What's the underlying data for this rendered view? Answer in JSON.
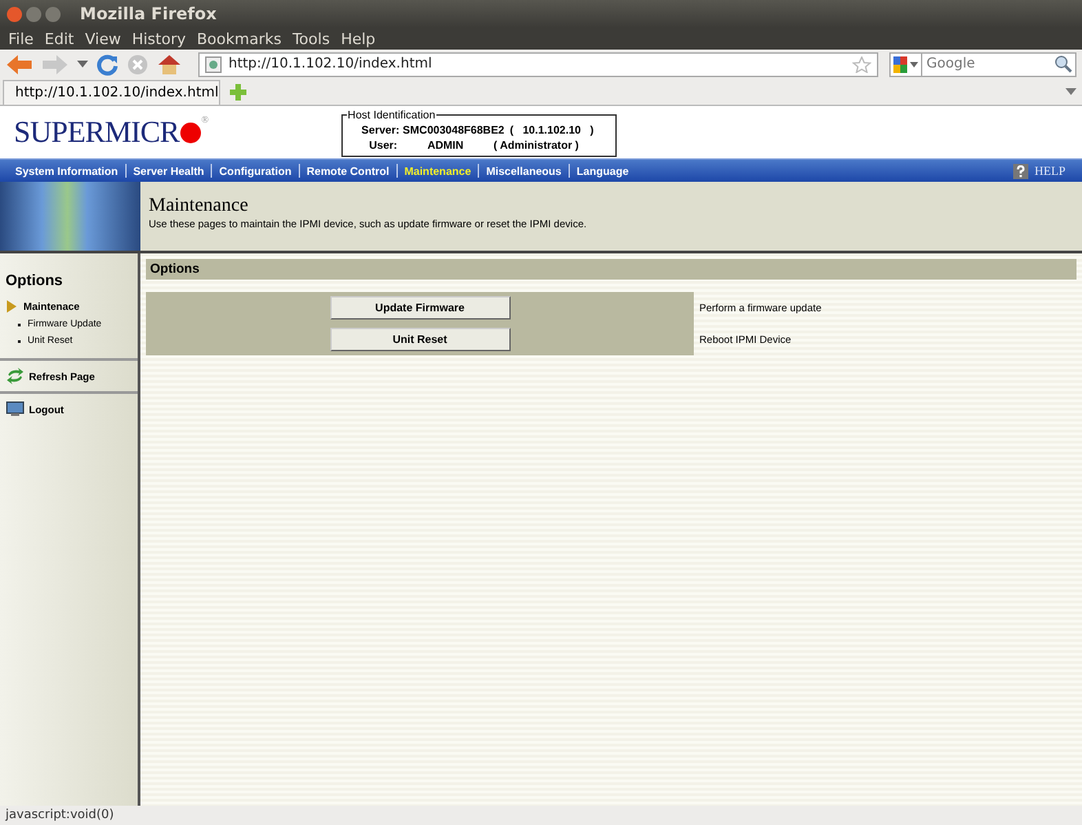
{
  "window": {
    "title": "Mozilla Firefox"
  },
  "menu": [
    "File",
    "Edit",
    "View",
    "History",
    "Bookmarks",
    "Tools",
    "Help"
  ],
  "address_bar": {
    "value": "http://10.1.102.10/index.html"
  },
  "search": {
    "placeholder": "Google"
  },
  "tabs": [
    {
      "label": "http://10.1.102.10/index.html",
      "selected": true
    }
  ],
  "page": {
    "logo": {
      "text": "SUPERMICR",
      "mark": "®"
    },
    "host": {
      "legend": "Host Identification",
      "server_label": "Server:",
      "server": "SMC003048F68BE2",
      "ip": "(   10.1.102.10   )",
      "user_label": "User:",
      "user": "ADMIN",
      "role": "( Administrator )"
    },
    "nav": [
      {
        "label": "System Information",
        "selected": false
      },
      {
        "label": "Server Health",
        "selected": false
      },
      {
        "label": "Configuration",
        "selected": false
      },
      {
        "label": "Remote Control",
        "selected": false
      },
      {
        "label": "Maintenance",
        "selected": true
      },
      {
        "label": "Miscellaneous",
        "selected": false
      },
      {
        "label": "Language",
        "selected": false
      }
    ],
    "help": "HELP",
    "banner": {
      "title": "Maintenance",
      "description": "Use these pages to maintain the IPMI device, such as update firmware or reset the IPMI device."
    },
    "sidebar": {
      "title": "Options",
      "section": "Maintenace",
      "items": [
        "Firmware Update",
        "Unit Reset"
      ],
      "links": [
        {
          "kind": "refresh",
          "label": "Refresh Page"
        },
        {
          "kind": "logout",
          "label": "Logout"
        }
      ]
    },
    "content": {
      "title": "Options",
      "actions": [
        {
          "button": "Update Firmware",
          "description": "Perform a firmware update"
        },
        {
          "button": "Unit Reset",
          "description": "Reboot IPMI Device"
        }
      ]
    }
  },
  "status_bar": "javascript:void(0)"
}
